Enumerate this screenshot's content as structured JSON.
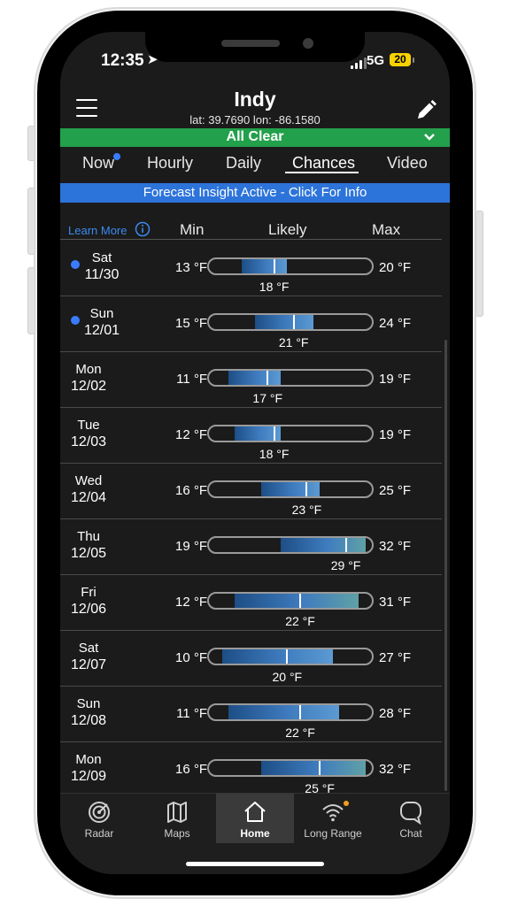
{
  "status_bar": {
    "time": "12:35",
    "network": "5G",
    "battery": "20"
  },
  "header": {
    "title": "Indy",
    "coords": "lat: 39.7690 lon: -86.1580"
  },
  "alert": {
    "text": "All Clear"
  },
  "tabs": [
    {
      "label": "Now"
    },
    {
      "label": "Hourly"
    },
    {
      "label": "Daily"
    },
    {
      "label": "Chances"
    },
    {
      "label": "Video"
    }
  ],
  "insight": {
    "text": "Forecast Insight Active - Click For Info"
  },
  "columns": {
    "learn_more": "Learn More",
    "min": "Min",
    "likely": "Likely",
    "max": "Max"
  },
  "colors": {
    "alert_green": "#22a04b",
    "insight_blue": "#2d74da",
    "accent_blue": "#3a7cff",
    "dark_bg": "#1b1b1b"
  },
  "scale": {
    "min_temp": 8,
    "max_temp": 33
  },
  "days": [
    {
      "day": "Sat",
      "date": "11/30",
      "dot": true,
      "min": 13,
      "likely": 18,
      "max": 20,
      "min_text": "13 °F",
      "likely_text": "18 °F",
      "max_text": "20 °F"
    },
    {
      "day": "Sun",
      "date": "12/01",
      "dot": true,
      "min": 15,
      "likely": 21,
      "max": 24,
      "min_text": "15 °F",
      "likely_text": "21 °F",
      "max_text": "24 °F"
    },
    {
      "day": "Mon",
      "date": "12/02",
      "dot": false,
      "min": 11,
      "likely": 17,
      "max": 19,
      "min_text": "11 °F",
      "likely_text": "17 °F",
      "max_text": "19 °F"
    },
    {
      "day": "Tue",
      "date": "12/03",
      "dot": false,
      "min": 12,
      "likely": 18,
      "max": 19,
      "min_text": "12 °F",
      "likely_text": "18 °F",
      "max_text": "19 °F"
    },
    {
      "day": "Wed",
      "date": "12/04",
      "dot": false,
      "min": 16,
      "likely": 23,
      "max": 25,
      "min_text": "16 °F",
      "likely_text": "23 °F",
      "max_text": "25 °F"
    },
    {
      "day": "Thu",
      "date": "12/05",
      "dot": false,
      "min": 19,
      "likely": 29,
      "max": 32,
      "min_text": "19 °F",
      "likely_text": "29 °F",
      "max_text": "32 °F"
    },
    {
      "day": "Fri",
      "date": "12/06",
      "dot": false,
      "min": 12,
      "likely": 22,
      "max": 31,
      "min_text": "12 °F",
      "likely_text": "22 °F",
      "max_text": "31 °F"
    },
    {
      "day": "Sat",
      "date": "12/07",
      "dot": false,
      "min": 10,
      "likely": 20,
      "max": 27,
      "min_text": "10 °F",
      "likely_text": "20 °F",
      "max_text": "27 °F"
    },
    {
      "day": "Sun",
      "date": "12/08",
      "dot": false,
      "min": 11,
      "likely": 22,
      "max": 28,
      "min_text": "11 °F",
      "likely_text": "22 °F",
      "max_text": "28 °F"
    },
    {
      "day": "Mon",
      "date": "12/09",
      "dot": false,
      "min": 16,
      "likely": 25,
      "max": 32,
      "min_text": "16 °F",
      "likely_text": "25 °F",
      "max_text": "32 °F"
    }
  ],
  "bottom_nav": [
    {
      "label": "Radar",
      "icon": "radar-icon"
    },
    {
      "label": "Maps",
      "icon": "map-icon"
    },
    {
      "label": "Home",
      "icon": "home-icon"
    },
    {
      "label": "Long Range",
      "icon": "wifi-icon"
    },
    {
      "label": "Chat",
      "icon": "chat-icon"
    }
  ]
}
